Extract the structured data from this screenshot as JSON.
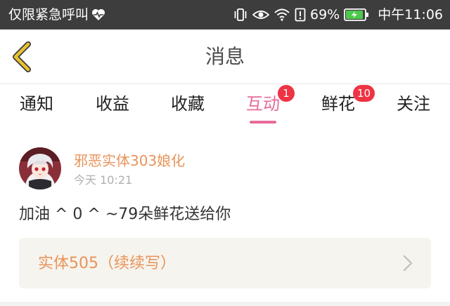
{
  "status_bar": {
    "left_text": "仅限紧急呼叫",
    "battery_percent": "69%",
    "time": "中午11:06",
    "icons": [
      "heart-pulse-icon",
      "vibrate-icon",
      "eye-icon",
      "wifi-icon",
      "alert-icon",
      "battery-icon"
    ]
  },
  "header": {
    "title": "消息",
    "back_icon": "chevron-left-icon"
  },
  "tabs": [
    {
      "label": "通知",
      "badge": ""
    },
    {
      "label": "收益",
      "badge": ""
    },
    {
      "label": "收藏",
      "badge": ""
    },
    {
      "label": "互动",
      "badge": "1",
      "active": true
    },
    {
      "label": "鲜花",
      "badge": "10"
    },
    {
      "label": "关注",
      "badge": ""
    }
  ],
  "message": {
    "username": "邪恶实体303娘化",
    "time": "今天 10:21",
    "text": "加油 ^ 0 ^ ~79朵鲜花送给你",
    "reference": "实体505（续续写）"
  },
  "colors": {
    "accent_pink": "#e76a9a",
    "badge_red": "#ee3344",
    "username_orange": "#e8935a",
    "back_arrow_yellow": "#e8c230"
  }
}
